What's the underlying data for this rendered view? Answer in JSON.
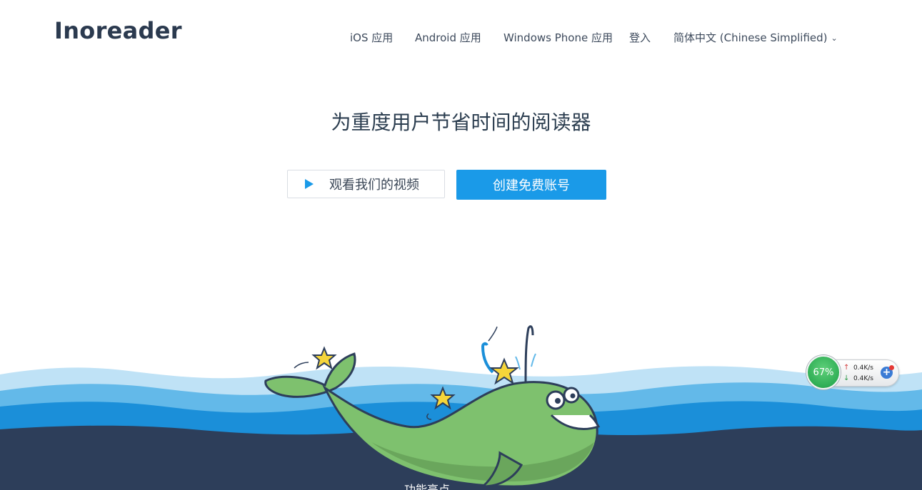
{
  "brand": {
    "name": "Inoreader"
  },
  "nav": {
    "items": [
      {
        "label": "iOS 应用"
      },
      {
        "label": "Android 应用"
      },
      {
        "label": "Windows Phone 应用"
      },
      {
        "label": "登入"
      },
      {
        "label": "简体中文 (Chinese Simplified)"
      }
    ]
  },
  "hero": {
    "headline": "为重度用户节省时间的阅读器",
    "watch_video_label": "观看我们的视频",
    "create_account_label": "创建免费账号",
    "partial_text": "功能亮点"
  },
  "colors": {
    "accent": "#1a9ae8",
    "text": "#2c3e50",
    "sea_dark": "#2d3e5a",
    "sea_mid": "#1b8fd9",
    "sea_light": "#63b9e9",
    "sea_pale": "#bfe2f6",
    "whale": "#7ec16e"
  },
  "net_monitor": {
    "percent": "67%",
    "upload": "0.4K/s",
    "download": "0.4K/s"
  }
}
